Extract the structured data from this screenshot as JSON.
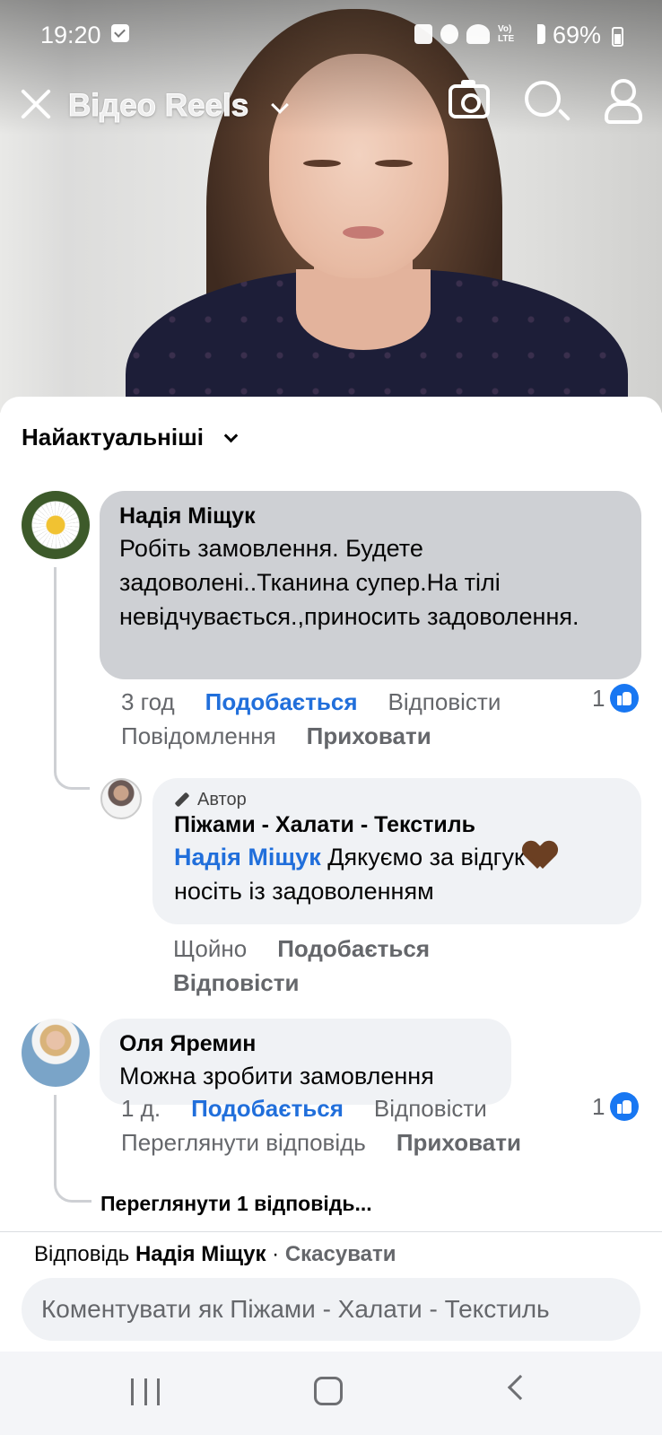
{
  "status": {
    "time": "19:20",
    "lte": "Vo) LTE",
    "battery": "69%"
  },
  "appbar": {
    "title": "Відео Reels"
  },
  "sort": {
    "label": "Найактуальніші"
  },
  "comments": [
    {
      "author": "Надія Міщук",
      "text": "Робіть замовлення. Будете задоволені..Тканина супер.На тілі невідчувається.,приносить задоволення.",
      "time": "3 год",
      "like": "Подобається",
      "reply": "Відповісти",
      "message": "Повідомлення",
      "hide": "Приховати",
      "like_count": "1"
    },
    {
      "badge": "Автор",
      "author": "Піжами - Халати - Текстиль",
      "mention": "Надія Міщук",
      "text": " Дякуємо за відгук",
      "text2": "носіть із задоволенням",
      "time": "Щойно",
      "like": "Подобається",
      "reply": "Відповісти"
    },
    {
      "author": "Оля Яремин",
      "text": "Можна зробити замовлення",
      "time": "1 д.",
      "like": "Подобається",
      "reply": "Відповісти",
      "view_reply": "Переглянути відповідь",
      "hide": "Приховати",
      "like_count": "1",
      "view_replies": "Переглянути 1 відповідь..."
    }
  ],
  "composer": {
    "replying_prefix": "Відповідь ",
    "replying_to": "Надія Міщук",
    "separator": " · ",
    "cancel": "Скасувати",
    "placeholder": "Коментувати як Піжами - Халати - Текстиль"
  },
  "colors": {
    "link": "#216fdb",
    "bubble": "#f0f2f5",
    "bubble_selected": "#ced0d4",
    "like_icon": "#1877f2"
  }
}
